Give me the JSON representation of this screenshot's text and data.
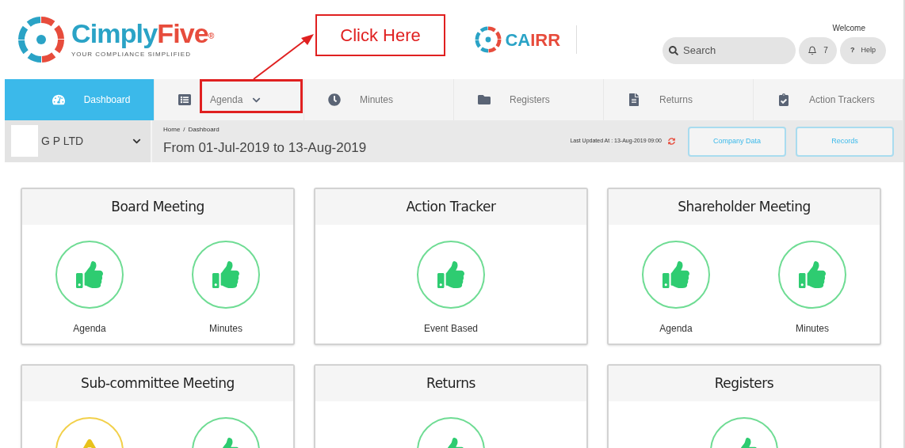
{
  "header": {
    "brand": {
      "parts": [
        "Cimply",
        "Five"
      ],
      "mark": "®",
      "tagline": "YOUR COMPLIANCE SIMPLIFIED"
    },
    "product": {
      "parts": [
        "CA",
        "IRR"
      ]
    },
    "welcome": "Welcome",
    "search": {
      "placeholder": "Search"
    },
    "notifications": "7",
    "help": {
      "icon": "?",
      "label": "Help"
    }
  },
  "nav": [
    {
      "label": "Dashboard",
      "selected": true,
      "dropdown": false
    },
    {
      "label": "Agenda",
      "selected": false,
      "dropdown": true
    },
    {
      "label": "Minutes",
      "selected": false,
      "dropdown": false
    },
    {
      "label": "Registers",
      "selected": false,
      "dropdown": false
    },
    {
      "label": "Returns",
      "selected": false,
      "dropdown": false
    },
    {
      "label": "Action Trackers",
      "selected": false,
      "dropdown": false
    }
  ],
  "subbar": {
    "company": "G P LTD",
    "breadcrumb": [
      "Home",
      "Dashboard"
    ],
    "separator": "/",
    "period": "From 01-Jul-2019 to 13-Aug-2019",
    "last_updated": "Last Updated At : 13-Aug-2019 09:00",
    "buttons": [
      "Company Data",
      "Records"
    ]
  },
  "cards": [
    {
      "title": "Board Meeting",
      "items": [
        {
          "label": "Agenda",
          "kind": "ok"
        },
        {
          "label": "Minutes",
          "kind": "ok"
        }
      ]
    },
    {
      "title": "Action Tracker",
      "items": [
        {
          "label": "Event Based",
          "kind": "ok"
        }
      ]
    },
    {
      "title": "Shareholder Meeting",
      "items": [
        {
          "label": "Agenda",
          "kind": "ok"
        },
        {
          "label": "Minutes",
          "kind": "ok"
        }
      ]
    },
    {
      "title": "Sub-committee Meeting",
      "items": [
        {
          "kind": "warning"
        },
        {
          "kind": "ok"
        }
      ]
    },
    {
      "title": "Returns",
      "items": [
        {
          "kind": "ok"
        }
      ]
    },
    {
      "title": "Registers",
      "items": [
        {
          "kind": "ok"
        }
      ]
    }
  ],
  "annotation": {
    "callout": "Click Here"
  }
}
